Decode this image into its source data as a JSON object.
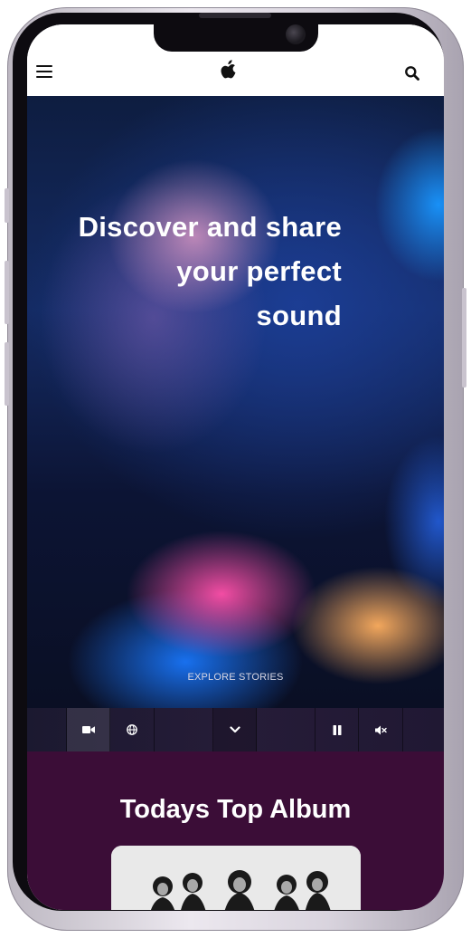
{
  "header": {
    "menu_icon": "hamburger-icon",
    "logo_icon": "apple-logo-icon",
    "search_icon": "search-icon"
  },
  "hero": {
    "headline_line1": "Discover and share",
    "headline_line2": "your perfect",
    "headline_line3": "sound",
    "explore_label": "EXPLORE STORIES"
  },
  "controls": {
    "items": [
      {
        "icon": "video-camera-icon"
      },
      {
        "icon": "globe-icon"
      },
      {
        "icon": "chevron-down-icon"
      },
      {
        "icon": "pause-icon"
      },
      {
        "icon": "mute-icon"
      }
    ]
  },
  "albums": {
    "title": "Todays Top Album"
  },
  "colors": {
    "album_section_bg": "#3b0d37",
    "control_bar_bg": "#201833"
  }
}
